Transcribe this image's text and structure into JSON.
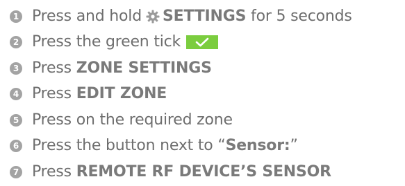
{
  "steps": [
    {
      "num": "1",
      "pre": "Press and hold",
      "bold": "SETTINGS",
      "post": " for 5 seconds",
      "icon": "gear-icon"
    },
    {
      "num": "2",
      "pre": "Press the green tick",
      "icon": "green-tick-button",
      "icon_color": "#7bcd3f"
    },
    {
      "num": "3",
      "pre": "Press ",
      "bold": "ZONE SETTINGS"
    },
    {
      "num": "4",
      "pre": "Press ",
      "bold": "EDIT ZONE"
    },
    {
      "num": "5",
      "pre": "Press on the required zone"
    },
    {
      "num": "6",
      "pre": "Press the button next to “",
      "bold": "Sensor:",
      "post": "”"
    },
    {
      "num": "7",
      "pre": "Press ",
      "bold": "REMOTE RF DEVICE’S SENSOR"
    }
  ]
}
